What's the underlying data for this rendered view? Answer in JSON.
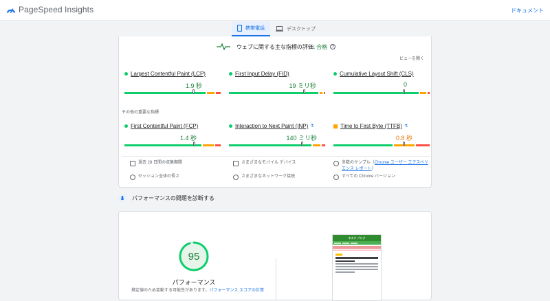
{
  "header": {
    "app_title": "PageSpeed Insights",
    "docs_link": "ドキュメント",
    "logo_icon": "pagespeed-logo-icon"
  },
  "tabs": [
    {
      "label": "携帯電話",
      "icon": "phone-icon",
      "active": true
    },
    {
      "label": "デスクトップ",
      "icon": "laptop-icon",
      "active": false
    }
  ],
  "assessment": {
    "label": "ウェブに関する主な指標の評価:",
    "result": "合格",
    "expand_view": "ビューを開く"
  },
  "core_metrics": [
    {
      "name": "Largest Contentful Paint (LCP)",
      "value": "1.9 秒",
      "status": "good",
      "experimental": false,
      "percentile": 0.72
    },
    {
      "name": "First Input Delay (FID)",
      "value": "19 ミリ秒",
      "status": "good",
      "experimental": false,
      "percentile": 0.78
    },
    {
      "name": "Cumulative Layout Shift (CLS)",
      "value": "0",
      "status": "good",
      "experimental": false,
      "percentile": 0.73
    }
  ],
  "other_heading": "その他の重要な指標",
  "other_metrics": [
    {
      "name": "First Contentful Paint (FCP)",
      "value": "1.4 秒",
      "status": "good",
      "experimental": false,
      "percentile": 0.72
    },
    {
      "name": "Interaction to Next Paint (INP)",
      "value": "140 ミリ秒",
      "status": "good",
      "experimental": true,
      "percentile": 0.75
    },
    {
      "name": "Time to First Byte (TTFB)",
      "value": "0.8 秒",
      "status": "average",
      "experimental": true,
      "percentile": 0.78
    }
  ],
  "details": [
    {
      "text": "過去 28 日間の収集期間",
      "icon": "calendar-icon"
    },
    {
      "text": "さまざまなモバイル デバイス",
      "icon": "devices-icon"
    },
    {
      "text_prefix": "多数のサンプル（",
      "link": "Chrome ユーザー エクスペリエンス レポート",
      "text_suffix": "）",
      "icon": "users-icon"
    },
    {
      "text": "セッション全体の長さ",
      "icon": "timer-icon"
    },
    {
      "text": "さまざまなネットワーク接続",
      "icon": "wifi-icon"
    },
    {
      "text": "すべての Chrome バージョン",
      "icon": "chrome-icon"
    }
  ],
  "diagnose": {
    "heading": "パフォーマンスの問題を診断する",
    "icon": "lighthouse-icon"
  },
  "performance": {
    "score": "95",
    "score_fraction": 0.95,
    "label": "パフォーマンス",
    "note_prefix": "推定値のため変動する可能性があります。",
    "note_link": "パフォーマンス スコアの計算"
  },
  "thumbnail": {
    "site_title": "ゆすけ ブログ"
  },
  "colors": {
    "good": "#0cce6b",
    "average": "#ffa400",
    "poor": "#ff4e42",
    "accent": "#1a73e8",
    "good_text": "#188038"
  }
}
